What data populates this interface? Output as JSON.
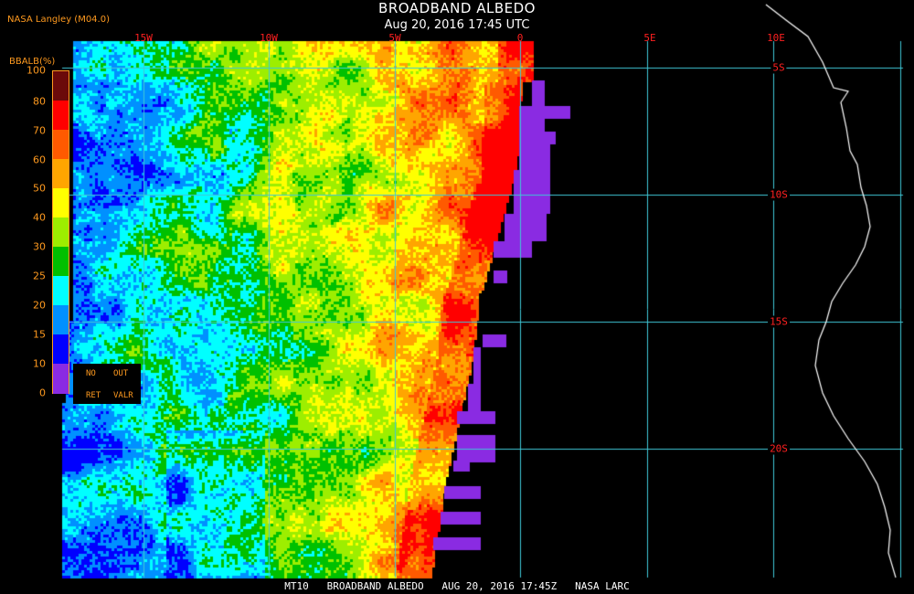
{
  "title": "BROADBAND ALBEDO",
  "timestamp": "Aug 20, 2016 17:45 UTC",
  "credit": "NASA Langley (M04.0)",
  "footer": "MT10   BROADBAND ALBEDO   AUG 20, 2016 17:45Z   NASA LARC",
  "longitude_labels": [
    "15W",
    "10W",
    "5W",
    "0",
    "5E",
    "10E"
  ],
  "latitude_labels": [
    "5S",
    "10S",
    "15S",
    "20S"
  ],
  "legend": {
    "title": "BBALB(%)",
    "ticks": [
      "100",
      "80",
      "70",
      "60",
      "50",
      "40",
      "30",
      "25",
      "20",
      "15",
      "10",
      "0"
    ],
    "colors": [
      "#6b0a0a",
      "#ff0000",
      "#ff5a00",
      "#ffa500",
      "#ffff00",
      "#9dee00",
      "#00c000",
      "#00ffff",
      "#0090ff",
      "#0000ff",
      "#8a2be2"
    ],
    "special": {
      "no": "NO",
      "out": "OUT",
      "ret": "RET",
      "valr": "VALR"
    }
  },
  "colors": {
    "grid": "#3fc8d8",
    "coast": "#ffffff",
    "no_retrieval": "#8a2be2",
    "labels": "#ff2020",
    "legend_text": "#ff9a1f"
  }
}
